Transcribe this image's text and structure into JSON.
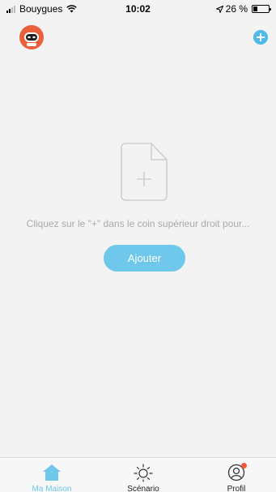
{
  "status_bar": {
    "carrier": "Bouygues",
    "time": "10:02",
    "battery_text": "26 %",
    "battery_level": 0.26
  },
  "header": {
    "avatar_icon": "robot-avatar-icon",
    "add_icon": "plus-circle-icon"
  },
  "empty_state": {
    "icon": "add-file-icon",
    "message": "Cliquez sur le \"+\" dans le coin supérieur droit pour...",
    "button_label": "Ajouter"
  },
  "tabbar": {
    "tabs": [
      {
        "label": "Ma Maison",
        "icon": "home-icon",
        "active": true
      },
      {
        "label": "Scénario",
        "icon": "sun-icon",
        "active": false
      },
      {
        "label": "Profil",
        "icon": "user-icon",
        "active": false
      }
    ]
  },
  "colors": {
    "accent": "#6fc7ec",
    "add_button": "#4ebbe8",
    "avatar": "#e9603b",
    "notification": "#f25a3c"
  }
}
